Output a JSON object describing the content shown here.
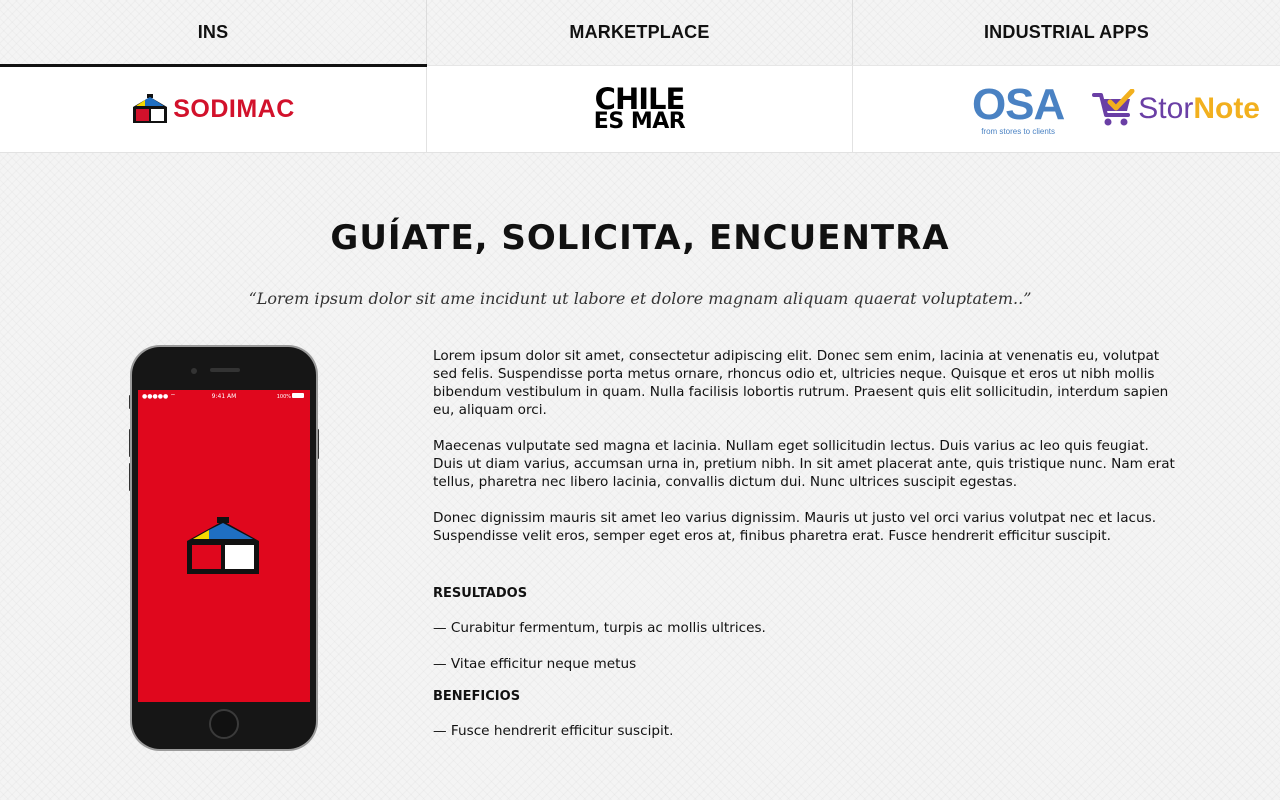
{
  "tabs": [
    {
      "label": "INS",
      "active": true
    },
    {
      "label": "MARKETPLACE",
      "active": false
    },
    {
      "label": "INDUSTRIAL APPS",
      "active": false
    }
  ],
  "logos": {
    "sodimac": "SODIMAC",
    "chile_es_mar": {
      "line1": "CHILE",
      "line2": "ES MAR"
    },
    "osa": {
      "main": "OSA",
      "tagline": "from stores to clients"
    },
    "stornote": {
      "part1": "Stor",
      "part2": "Note"
    }
  },
  "main": {
    "title": "GUÍATE, SOLICITA, ENCUENTRA",
    "quote": "“Lorem ipsum dolor sit ame incidunt ut labore et dolore magnam aliquam quaerat voluptatem..”",
    "paragraphs": [
      "Lorem ipsum dolor sit amet, consectetur adipiscing elit. Donec sem enim, lacinia at venenatis eu, volutpat sed felis. Suspendisse porta metus ornare, rhoncus odio et, ultricies neque. Quisque et eros ut nibh mollis bibendum vestibulum in quam. Nulla facilisis lobortis rutrum. Praesent quis elit sollicitudin, interdum sapien eu, aliquam orci.",
      "Maecenas vulputate sed magna et lacinia. Nullam eget sollicitudin lectus. Duis varius ac leo quis feugiat. Duis ut diam varius, accumsan urna in, pretium nibh. In sit amet placerat ante, quis tristique nunc. Nam erat tellus, pharetra nec libero lacinia, convallis dictum dui. Nunc ultrices suscipit egestas.",
      "Donec dignissim mauris sit amet leo varius dignissim. Mauris ut justo vel orci varius volutpat nec et lacus. Suspendisse velit eros, semper eget eros at, finibus pharetra erat. Fusce hendrerit efficitur suscipit."
    ],
    "results": {
      "heading": "RESULTADOS",
      "items": [
        "— Curabitur fermentum, turpis ac mollis ultrices.",
        "— Vitae efficitur neque metus"
      ]
    },
    "benefits": {
      "heading": "BENEFICIOS",
      "items": [
        "— Fusce hendrerit efficitur suscipit."
      ]
    }
  },
  "phone": {
    "time": "9:41 AM",
    "battery": "100%"
  },
  "colors": {
    "sodimac_red": "#d2112b",
    "app_red": "#e0071d",
    "osa_blue": "#4a82c3",
    "stornote_purple": "#6a3fa5",
    "stornote_yellow": "#f2b01e"
  }
}
